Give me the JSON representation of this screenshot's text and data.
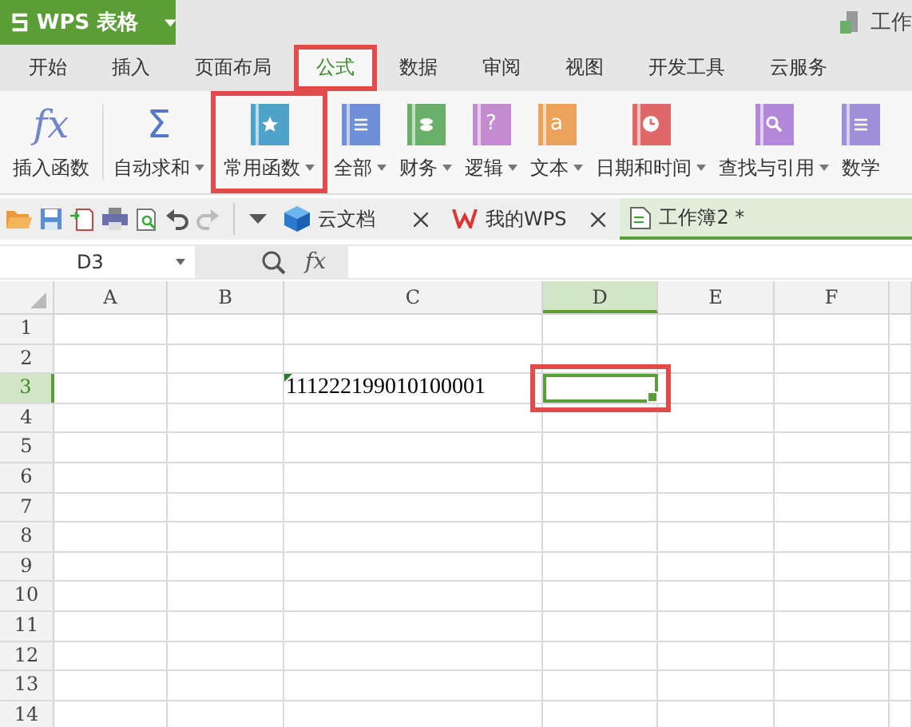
{
  "app_button": {
    "label": "WPS 表格"
  },
  "title": "工作",
  "tabs": [
    {
      "label": "开始",
      "selected": false,
      "annotated": false
    },
    {
      "label": "插入",
      "selected": false,
      "annotated": false
    },
    {
      "label": "页面布局",
      "selected": false,
      "annotated": false
    },
    {
      "label": "公式",
      "selected": true,
      "annotated": true
    },
    {
      "label": "数据",
      "selected": false,
      "annotated": false
    },
    {
      "label": "审阅",
      "selected": false,
      "annotated": false
    },
    {
      "label": "视图",
      "selected": false,
      "annotated": false
    },
    {
      "label": "开发工具",
      "selected": false,
      "annotated": false
    },
    {
      "label": "云服务",
      "selected": false,
      "annotated": false
    }
  ],
  "ribbon": [
    {
      "label": "插入函数",
      "kind": "glyph",
      "glyph": "fx",
      "dropdown": false,
      "annotated": false
    },
    {
      "label": "自动求和",
      "kind": "glyph",
      "glyph": "Σ",
      "dropdown": true,
      "annotated": false
    },
    {
      "label": "常用函数",
      "kind": "star",
      "color": "#4fa3c9",
      "dropdown": true,
      "annotated": true
    },
    {
      "label": "全部",
      "kind": "list",
      "color": "#6f8fd8",
      "dropdown": true,
      "annotated": false
    },
    {
      "label": "财务",
      "kind": "coins",
      "color": "#6ab06a",
      "dropdown": true,
      "annotated": false
    },
    {
      "label": "逻辑",
      "kind": "book",
      "glyph": "?",
      "color": "#c58bd0",
      "dropdown": true,
      "annotated": false
    },
    {
      "label": "文本",
      "kind": "book",
      "glyph": "a",
      "color": "#eba25a",
      "dropdown": true,
      "annotated": false
    },
    {
      "label": "日期和时间",
      "kind": "clock",
      "color": "#e06767",
      "dropdown": true,
      "annotated": false
    },
    {
      "label": "查找与引用",
      "kind": "search",
      "color": "#b488d8",
      "dropdown": true,
      "annotated": false
    },
    {
      "label": "数学",
      "kind": "list",
      "color": "#9d8fd8",
      "dropdown": false,
      "annotated": false
    }
  ],
  "doc_tabs": [
    {
      "label": "云文档",
      "kind": "cloud",
      "closable": true,
      "selected": false
    },
    {
      "label": "我的WPS",
      "kind": "wps",
      "closable": true,
      "selected": false
    },
    {
      "label": "工作簿2 *",
      "kind": "sheet",
      "closable": false,
      "selected": true
    }
  ],
  "formula_bar": {
    "name_box": "D3",
    "fx": "fx"
  },
  "grid": {
    "columns": [
      {
        "label": "A",
        "selected": false
      },
      {
        "label": "B",
        "selected": false
      },
      {
        "label": "C",
        "selected": false
      },
      {
        "label": "D",
        "selected": true
      },
      {
        "label": "E",
        "selected": false
      },
      {
        "label": "F",
        "selected": false
      }
    ],
    "rows": [
      {
        "label": "1",
        "selected": false
      },
      {
        "label": "2",
        "selected": false
      },
      {
        "label": "3",
        "selected": true,
        "cells": [
          {
            "selected": false
          },
          {
            "selected": false
          },
          {
            "selected": false,
            "text": "111222199010100001",
            "flag": true
          },
          {
            "selected": true,
            "annotated": true
          },
          {
            "selected": false
          },
          {
            "selected": false
          }
        ]
      },
      {
        "label": "4",
        "selected": false
      },
      {
        "label": "5",
        "selected": false
      },
      {
        "label": "6",
        "selected": false
      },
      {
        "label": "7",
        "selected": false
      },
      {
        "label": "8",
        "selected": false
      },
      {
        "label": "9",
        "selected": false
      },
      {
        "label": "10",
        "selected": false
      },
      {
        "label": "11",
        "selected": false
      },
      {
        "label": "12",
        "selected": false
      },
      {
        "label": "13",
        "selected": false
      },
      {
        "label": "14",
        "selected": false
      }
    ]
  }
}
